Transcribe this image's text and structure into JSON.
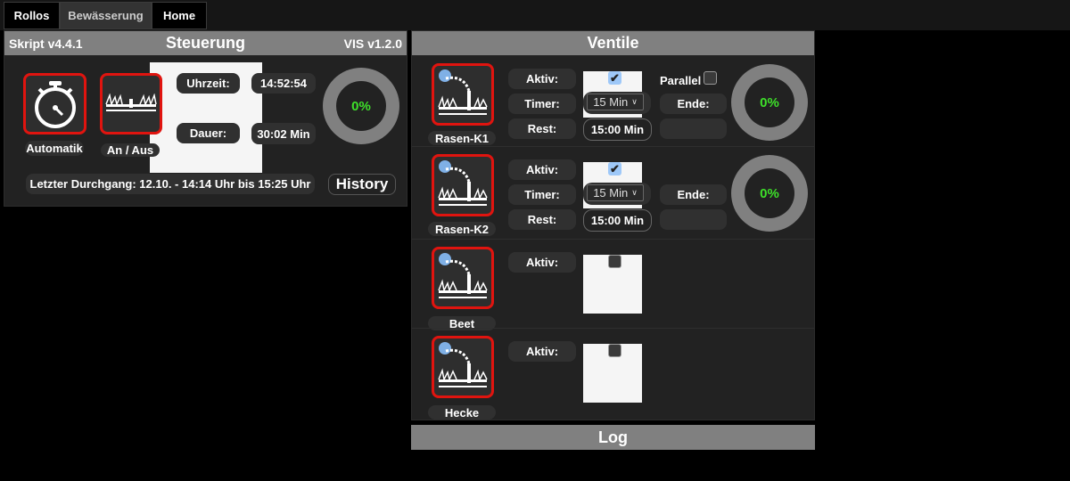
{
  "tabs": [
    {
      "label": "Rollos"
    },
    {
      "label": "Bewässerung",
      "active": true
    },
    {
      "label": "Home"
    }
  ],
  "steuerung": {
    "script_version": "Skript v4.4.1",
    "title": "Steuerung",
    "vis_version": "VIS v1.2.0",
    "automatik_label": "Automatik",
    "an_aus_label": "An / Aus",
    "uhrzeit_label": "Uhrzeit:",
    "uhrzeit_value": "14:52:54",
    "dauer_label": "Dauer:",
    "dauer_value": "30:02 Min",
    "progress": "0%",
    "last_run": "Letzter Durchgang: 12.10. - 14:14 Uhr bis 15:25 Uhr",
    "history_label": "History"
  },
  "ventile": {
    "title": "Ventile",
    "valves": [
      {
        "name": "Rasen-K1",
        "aktiv_label": "Aktiv:",
        "aktiv": true,
        "timer_label": "Timer:",
        "timer": "15 Min",
        "rest_label": "Rest:",
        "rest": "15:00 Min",
        "parallel_label": "Parallel",
        "parallel": false,
        "ende_label": "Ende:",
        "ende": "",
        "progress": "0%"
      },
      {
        "name": "Rasen-K2",
        "aktiv_label": "Aktiv:",
        "aktiv": true,
        "timer_label": "Timer:",
        "timer": "15 Min",
        "rest_label": "Rest:",
        "rest": "15:00 Min",
        "ende_label": "Ende:",
        "ende": "",
        "progress": "0%"
      },
      {
        "name": "Beet",
        "aktiv_label": "Aktiv:",
        "aktiv": false
      },
      {
        "name": "Hecke",
        "aktiv_label": "Aktiv:",
        "aktiv": false
      }
    ]
  },
  "log": {
    "title": "Log"
  },
  "colors": {
    "accent_border": "#e0140f",
    "progress_text": "#3ee02a",
    "header": "#808080"
  }
}
